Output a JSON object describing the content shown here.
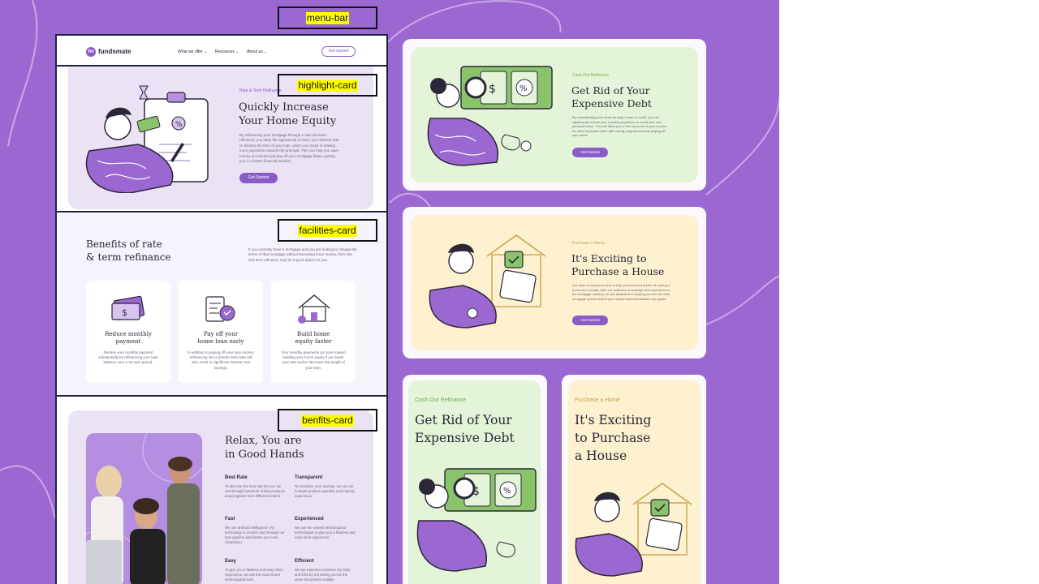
{
  "labels": {
    "menu_bar": "menu-bar",
    "highlight_card": "highlight-card",
    "facilities_card": "facilities-card",
    "benefits_card": "benfits-card"
  },
  "brand": {
    "logo_mark": "fm",
    "logo_text": "fundsmate"
  },
  "nav": {
    "items": [
      "What we offer",
      "Resources",
      "About us"
    ],
    "cta": "Get started"
  },
  "rate_term": {
    "eyebrow": "Rate & Term Refinance",
    "title_line1": "Quickly Increase",
    "title_line2": "Your Home Equity",
    "body": "By refinancing your mortgage through a rate and term refinance, you have the opportunity to lower your interest rate or shorten the term of your loan, which can result in making more payments towards the principal. This can help you save money on interest and pay off your mortgage faster, putting you in a better financial position.",
    "button": "Get Started"
  },
  "benefits": {
    "title_line1": "Benefits of rate",
    "title_line2": "& term refinance",
    "intro": "If you currently have a mortgage and you are looking to change the terms of that mortgage without borrowing more money, then rate and term refinance may be a good option for you.",
    "cards": [
      {
        "title_line1": "Reduce monthly",
        "title_line2": "payment",
        "body": "Reduce your monthly payment substantially by refinancing your loan balance over a 30-year period.",
        "icon": "money-card-icon"
      },
      {
        "title_line1": "Pay off your",
        "title_line2": "home loan early",
        "body": "In addition to paying off your loan sooner, refinancing into a shorter term loan will also result in significant interest cost savings.",
        "icon": "invoice-heart-icon"
      },
      {
        "title_line1": "Build home",
        "title_line2": "equity faster",
        "body": "Your monthly payments go more toward building your home equity if you lower your rate and/or decrease the length of your loan.",
        "icon": "house-icon"
      }
    ]
  },
  "good_hands": {
    "title_line1": "Relax, You are",
    "title_line2": "in Good Hands",
    "features": [
      {
        "title": "Best Rate",
        "body": "To discover the best rate for you, we sort through hundreds of loan products and programs from different lenders."
      },
      {
        "title": "Transparent",
        "body": "To maximize your savings, we use our in-depth product expertise and industry experience."
      },
      {
        "title": "Fast",
        "body": "We use artificial intelligence (AI) technology to monitor and manage our loan pipeline and hasten your loan completion."
      },
      {
        "title": "Experienced",
        "body": "We use the newest technological technologies to give you a flawless and easy client experience."
      },
      {
        "title": "Easy",
        "body": "To give you a flawless and easy client experience, we use the most recent technological tools."
      },
      {
        "title": "Efficient",
        "body": "We are trained to minimize the back and forth by not asking you for the same documents multiple"
      }
    ]
  },
  "cash_out": {
    "eyebrow": "Cash Out Refinance",
    "title_line1": "Get Rid of Your",
    "title_line2": "Expensive Debt",
    "body": "By consolidating your debts through a loan or credit, you can significantly reduce your monthly payments on credit card and personal loans. This will allow you to free up some of your income for other expenses while still making progress towards paying off your debts.",
    "button": "Get Started"
  },
  "purchase": {
    "eyebrow": "Purchase a Home",
    "title_line1": "It's Exciting to",
    "title_line2": "Purchase a House",
    "body": "Our team of experts is here to help you turn your dream of owning a home into a reality. With our extensive knowledge and experience in the mortgage industry, we are dedicated to helping you find the best mortgage options that fit your unique financial situation and goals.",
    "button": "Get Started"
  },
  "mobile_cash_out": {
    "eyebrow": "Cash Out Refinance",
    "title_line1": "Get Rid of Your",
    "title_line2": "Expensive Debt"
  },
  "mobile_purchase": {
    "eyebrow": "Purchase a Home",
    "title_line1": "It's Exciting",
    "title_line2": "to Purchase",
    "title_line3": "a House"
  },
  "colors": {
    "background": "#9a68d0",
    "brand_purple": "#8a5cc7",
    "lavender_card": "#ece2f6",
    "green_card": "#e4f4d8",
    "yellow_card": "#fdf1cf",
    "green_accent": "#8ac46a",
    "yellow_accent": "#c9a44a"
  }
}
